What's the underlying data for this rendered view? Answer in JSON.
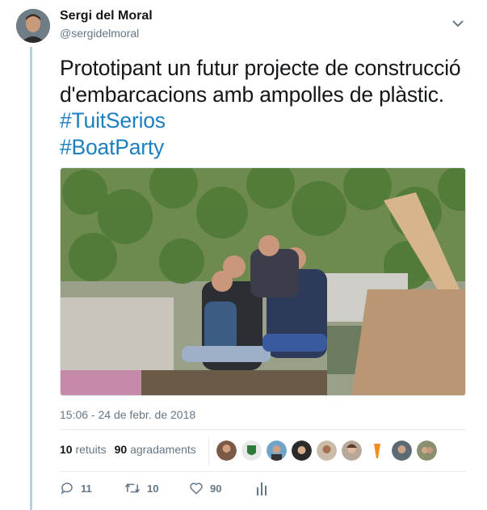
{
  "author": {
    "display_name": "Sergi del Moral",
    "handle": "@sergidelmoral"
  },
  "tweet": {
    "text": "Prototipant un futur projecte de construcció d'embarcacions amb ampolles de plàstic.",
    "hashtags": [
      "#TuitSerios",
      "#BoatParty"
    ],
    "timestamp": "15:06 - 24 de febr. de 2018"
  },
  "stats": {
    "retweets_count": "10",
    "retweets_label": "retuits",
    "likes_count": "90",
    "likes_label": "agradaments"
  },
  "liker_avatars": [
    "avatar-1",
    "avatar-2",
    "avatar-3",
    "avatar-4",
    "avatar-5",
    "avatar-6",
    "avatar-7",
    "avatar-8",
    "avatar-9"
  ],
  "actions": {
    "reply_count": "11",
    "retweet_count": "10",
    "like_count": "90"
  },
  "colors": {
    "link": "#1c7fbf",
    "thread": "#b3d4dd",
    "muted": "#657786"
  }
}
